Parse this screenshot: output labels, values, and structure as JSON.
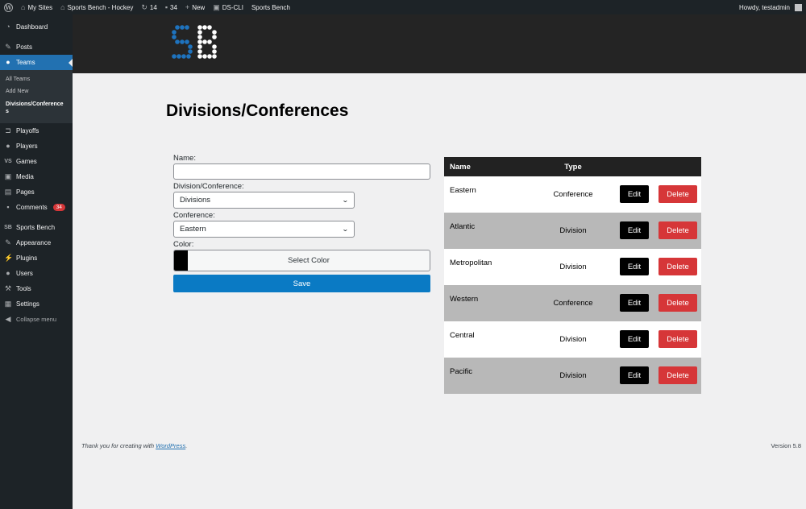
{
  "admin_bar": {
    "my_sites": "My Sites",
    "site_name": "Sports Bench - Hockey",
    "updates_count": "14",
    "comments_count": "34",
    "new_label": "New",
    "ds_cli": "DS-CLI",
    "sports_bench": "Sports Bench",
    "howdy": "Howdy, testadmin"
  },
  "sidebar": {
    "dashboard": "Dashboard",
    "posts": "Posts",
    "teams": "Teams",
    "teams_sub": {
      "all_teams": "All Teams",
      "add_new": "Add New",
      "divisions": "Divisions/Conference\ns"
    },
    "playoffs": "Playoffs",
    "players": "Players",
    "games": "Games",
    "media": "Media",
    "pages": "Pages",
    "comments": "Comments",
    "comments_badge": "34",
    "sports_bench": "Sports Bench",
    "appearance": "Appearance",
    "plugins": "Plugins",
    "users": "Users",
    "tools": "Tools",
    "settings": "Settings",
    "collapse": "Collapse menu"
  },
  "page": {
    "title": "Divisions/Conferences"
  },
  "form": {
    "name_label": "Name:",
    "name_value": "",
    "division_label": "Division/Conference:",
    "division_value": "Divisions",
    "conference_label": "Conference:",
    "conference_value": "Eastern",
    "color_label": "Color:",
    "color_value": "#000000",
    "select_color": "Select Color",
    "save": "Save"
  },
  "table": {
    "headers": {
      "name": "Name",
      "type": "Type"
    },
    "edit_label": "Edit",
    "delete_label": "Delete",
    "rows": [
      {
        "name": "Eastern",
        "type": "Conference"
      },
      {
        "name": "Atlantic",
        "type": "Division"
      },
      {
        "name": "Metropolitan",
        "type": "Division"
      },
      {
        "name": "Western",
        "type": "Conference"
      },
      {
        "name": "Central",
        "type": "Division"
      },
      {
        "name": "Pacific",
        "type": "Division"
      }
    ]
  },
  "footer": {
    "thanks_prefix": "Thank you for creating with ",
    "thanks_link": "WordPress",
    "thanks_suffix": ".",
    "version": "Version 5.8"
  },
  "colors": {
    "accent": "#2271b1",
    "save_button": "#0a7ac4",
    "delete_button": "#d63638",
    "logo_blue": "#1e73be"
  },
  "icons": {
    "wordpress": "wordpress-logo-icon",
    "my_sites": "my-sites-icon",
    "home": "home-icon",
    "updates": "updates-icon",
    "comments": "comment-icon",
    "new": "plus-icon",
    "sports_bench": "sports-bench-logo-icon"
  }
}
